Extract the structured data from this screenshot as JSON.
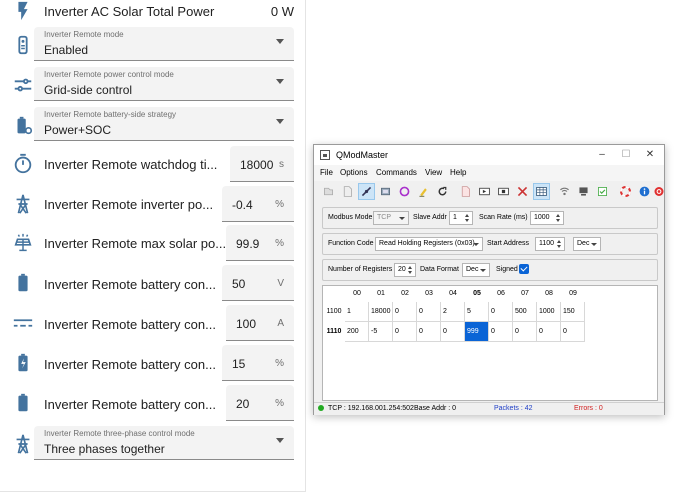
{
  "panel": {
    "top": {
      "label": "Inverter AC Solar Total Power",
      "value": "0 W"
    },
    "selects": [
      {
        "caption": "Inverter Remote mode",
        "value": "Enabled"
      },
      {
        "caption": "Inverter Remote power control mode",
        "value": "Grid-side control"
      },
      {
        "caption": "Inverter Remote battery-side strategy",
        "value": "Power+SOC"
      },
      {
        "caption": "Inverter Remote three-phase control mode",
        "value": "Three phases together"
      }
    ],
    "numbers": [
      {
        "label": "Inverter Remote watchdog ti...",
        "value": "18000",
        "unit": "s"
      },
      {
        "label": "Inverter Remote inverter po...",
        "value": "-0.4",
        "unit": "%"
      },
      {
        "label": "Inverter Remote max solar po...",
        "value": "99.9",
        "unit": "%"
      },
      {
        "label": "Inverter Remote battery con...",
        "value": "50",
        "unit": "V"
      },
      {
        "label": "Inverter Remote battery con...",
        "value": "100",
        "unit": "A"
      },
      {
        "label": "Inverter Remote battery con...",
        "value": "15",
        "unit": "%"
      },
      {
        "label": "Inverter Remote battery con...",
        "value": "20",
        "unit": "%"
      }
    ]
  },
  "qmod": {
    "title": "QModMaster",
    "window_buttons": {
      "minimize": "–",
      "maximize": "☐",
      "close": "✕"
    },
    "menu": [
      "File",
      "Options",
      "Commands",
      "View",
      "Help"
    ],
    "toolbar_icons": [
      "open-icon",
      "save-icon",
      "connect-icon",
      "scan-icon",
      "reset-icon",
      "clear-icon",
      "refresh-icon",
      "read-icon",
      "play-icon",
      "stop-icon",
      "tools-icon",
      "table-icon",
      "bus-monitor-icon",
      "server-icon",
      "log-icon",
      "help-icon",
      "info-icon",
      "exit-icon"
    ],
    "settings": {
      "modbus_mode_label": "Modbus Mode",
      "modbus_mode": "TCP",
      "slave_addr_label": "Slave Addr",
      "slave_addr": "1",
      "scan_rate_label": "Scan Rate (ms)",
      "scan_rate": "1000",
      "function_code_label": "Function Code",
      "function_code": "Read Holding Registers (0x03)",
      "start_address_label": "Start Address",
      "start_address": "1100",
      "start_address_format": "Dec",
      "num_registers_label": "Number of Registers",
      "num_registers": "20",
      "data_format_label": "Data Format",
      "data_format": "Dec",
      "signed_label": "Signed",
      "signed": true
    },
    "grid": {
      "columns": [
        "00",
        "01",
        "02",
        "03",
        "04",
        "05",
        "06",
        "07",
        "08",
        "09"
      ],
      "active_column": "05",
      "rows": [
        {
          "header": "1100",
          "cells": [
            "1",
            "18000",
            "0",
            "0",
            "2",
            "5",
            "0",
            "500",
            "1000",
            "150"
          ]
        },
        {
          "header": "1110",
          "cells": [
            "200",
            "-5",
            "0",
            "0",
            "0",
            "999",
            "0",
            "0",
            "0",
            "0"
          ]
        }
      ],
      "selected_cell": "999"
    },
    "status": {
      "connection": "TCP : 192.168.001.254:502",
      "base_addr": "Base Addr : 0",
      "packets": "Packets : 42",
      "errors": "Errors : 0"
    }
  },
  "colors": {
    "ha_icon": "#44739e",
    "selection": "#0a64d6",
    "packets": "#1f3fc6",
    "errors": "#d02020"
  }
}
